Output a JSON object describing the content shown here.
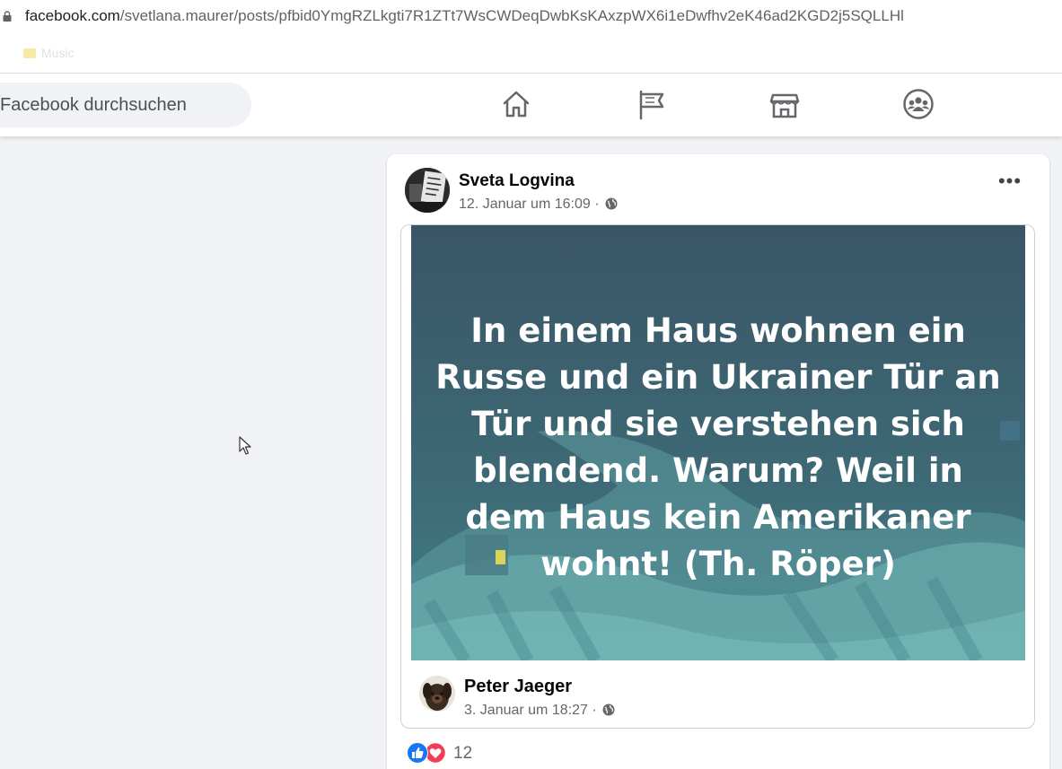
{
  "browser": {
    "url_host": "facebook.com",
    "url_path": "/svetlana.maurer/posts/pfbid0YmgRZLkgti7R1ZTt7WsCWDeqDwbKsKAxzpWX6i1eDwfhv2eK46ad2KGD2j5SQLLHl",
    "bookmarks": [
      "Music"
    ]
  },
  "header": {
    "search_placeholder": "Facebook durchsuchen",
    "nav_icons": [
      "home-icon",
      "pages-flag-icon",
      "marketplace-icon",
      "groups-icon"
    ]
  },
  "post": {
    "author": "Sveta Logvina",
    "timestamp": "12. Januar um 16:09 ·",
    "privacy_icon": "globe-icon",
    "shared": {
      "image_text": "In einem Haus wohnen ein Russe und ein Ukrainer Tür an Tür und sie verstehen sich blendend. Warum? Weil in dem Haus kein Amerikaner wohnt! (Th. Röper)",
      "author": "Peter Jaeger",
      "timestamp": "3. Januar um 18:27 ·"
    },
    "reactions": {
      "types": [
        "like",
        "love"
      ],
      "count": "12"
    }
  },
  "colors": {
    "fb_blue": "#1877f2",
    "love_red": "#f33e58",
    "image_bg_top": "#3a5566",
    "image_bg_bottom": "#3f7f86"
  }
}
